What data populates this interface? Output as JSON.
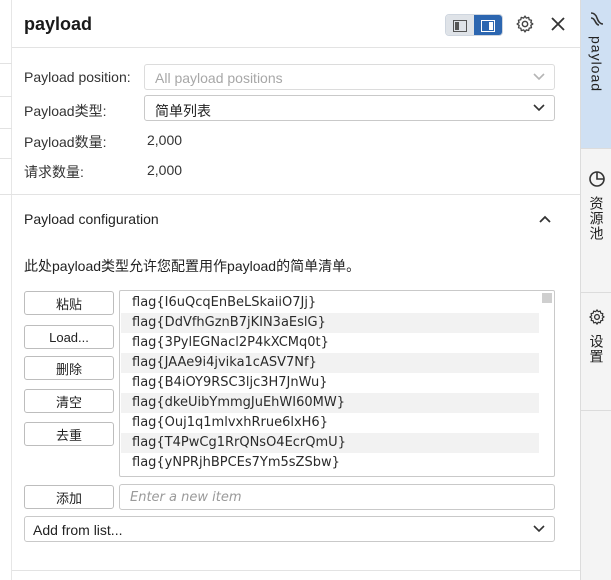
{
  "header": {
    "title": "payload"
  },
  "positions_row": {
    "label": "Payload position:",
    "value": "All payload positions"
  },
  "type_row": {
    "label": "Payload类型:",
    "value": "简单列表"
  },
  "count_row": {
    "label": "Payload数量:",
    "value": "2,000"
  },
  "request_row": {
    "label": "请求数量:",
    "value": "2,000"
  },
  "config": {
    "title": "Payload configuration",
    "description": "此处payload类型允许您配置用作payload的简单清单。"
  },
  "buttons": {
    "paste": "粘贴",
    "load": "Load...",
    "delete": "删除",
    "clear": "清空",
    "dedupe": "去重",
    "add": "添加"
  },
  "payload_items": [
    "flag{I6uQcqEnBeLSkaiiO7Jj}",
    "flag{DdVfhGznB7jKIN3aEslG}",
    "flag{3PylEGNacl2P4kXCMq0t}",
    "flag{JAAe9i4jvika1cASV7Nf}",
    "flag{B4iOY9RSC3ljc3H7JnWu}",
    "flag{dkeUibYmmgJuEhWI60MW}",
    "flag{Ouj1q1mlvxhRrue6lxH6}",
    "flag{T4PwCg1RrQNsO4EcrQmU}",
    "flag{yNPRjhBPCEs7Ym5sZSbw}"
  ],
  "add_item": {
    "placeholder": "Enter a new item",
    "value": ""
  },
  "add_from_list": {
    "label": "Add from list..."
  },
  "right_rail": {
    "tabs": [
      {
        "label": "payload",
        "icon": "payload-icon",
        "active": true
      },
      {
        "label": "资源池",
        "icon": "pie-chart-icon",
        "active": false
      },
      {
        "label": "设置",
        "icon": "gear-icon",
        "active": false
      }
    ]
  },
  "colors": {
    "accent": "#2c66b0",
    "active_tab": "#cfe0f3",
    "border": "#c9c9c9"
  }
}
